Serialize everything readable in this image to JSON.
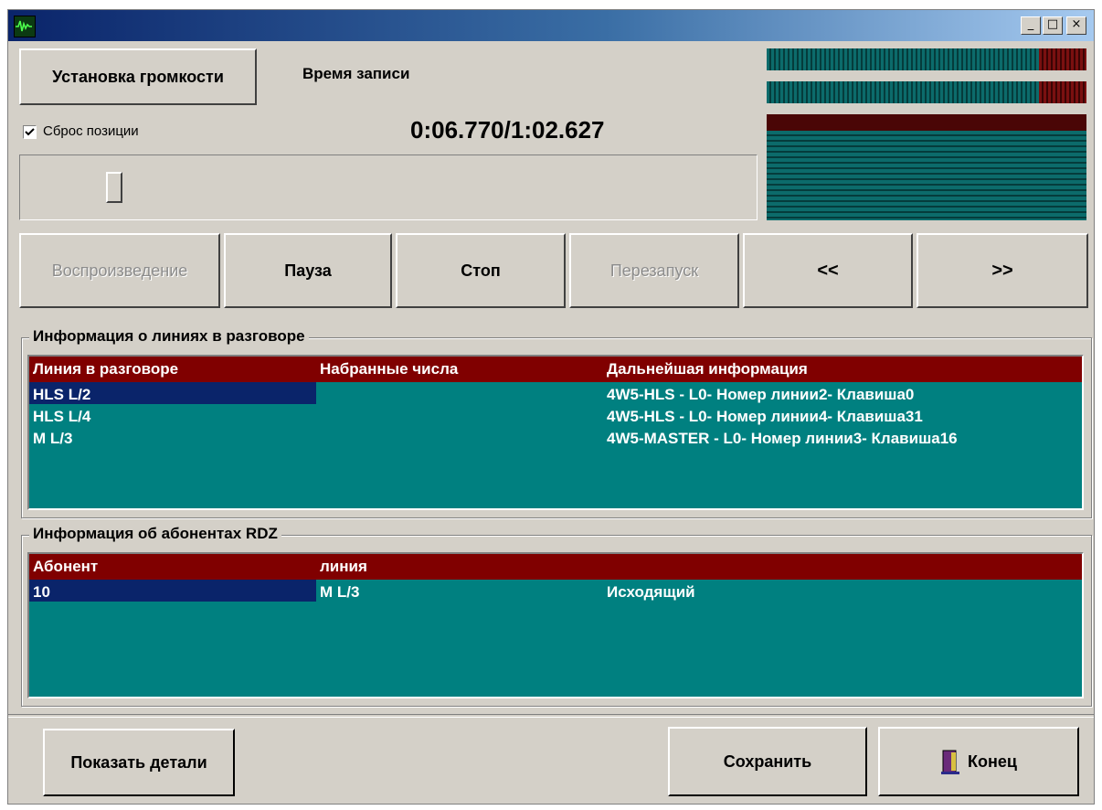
{
  "window": {
    "app_icon": "waveform-icon",
    "controls": {
      "minimize": "_",
      "maximize": "□",
      "close": "×"
    }
  },
  "top": {
    "volume_button": "Установка громкости",
    "record_time_label": "Время записи",
    "reset_position_label": "Сброс позиции",
    "reset_position_checked": true,
    "time_display": "0:06.770/1:02.627",
    "position_slider": 0.0
  },
  "meters": {
    "left_level": 0.85,
    "right_level": 0.85,
    "spectrum_hot_rows": 1
  },
  "transport": {
    "play": "Воспроизведение",
    "pause": "Пауза",
    "stop": "Стоп",
    "restart": "Перезапуск",
    "rewind": "<<",
    "forward": ">>"
  },
  "lines_group": {
    "title": "Информация о линиях в разговоре",
    "columns": [
      "Линия в разговоре",
      "Набранные числа",
      "Дальнейшая информация"
    ],
    "rows": [
      [
        "HLS L/2",
        "",
        "4W5-HLS - L0- Номер линии2- Клавиша0"
      ],
      [
        "HLS L/4",
        "",
        "4W5-HLS - L0- Номер линии4- Клавиша31"
      ],
      [
        "M L/3",
        "",
        "4W5-MASTER - L0- Номер линии3- Клавиша16"
      ]
    ]
  },
  "rdz_group": {
    "title": "Информация об абонентах RDZ",
    "columns": [
      "Абонент",
      "линия",
      ""
    ],
    "rows": [
      [
        "10",
        "M L/3",
        "Исходящий"
      ]
    ]
  },
  "bottom": {
    "details_button": "Показать детали",
    "save_button": "Сохранить",
    "exit_button": "Конец",
    "exit_icon": "door-exit-icon",
    "colors": {
      "grid_bg": "#008080",
      "header_bg": "#800000",
      "selection": "#0a246a"
    }
  }
}
